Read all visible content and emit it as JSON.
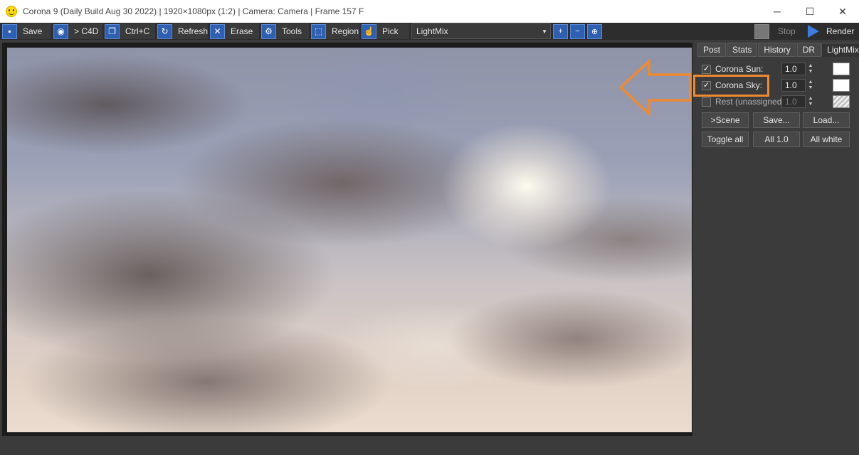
{
  "window": {
    "title": "Corona 9 (Daily Build Aug 30 2022) | 1920×1080px (1:2) | Camera: Camera | Frame 157 F",
    "minimize": "─",
    "maximize": "☐",
    "close": "✕"
  },
  "toolbar": {
    "save": "Save",
    "to_c4d": "> C4D",
    "copy": "Ctrl+C",
    "refresh": "Refresh",
    "erase": "Erase",
    "tools": "Tools",
    "region": "Region",
    "pick": "Pick",
    "lightmix_select": "LightMix",
    "stop": "Stop",
    "render": "Render"
  },
  "panel": {
    "tabs": [
      "Post",
      "Stats",
      "History",
      "DR",
      "LightMix"
    ],
    "active_tab": "LightMix",
    "lights": [
      {
        "label": "Corona Sun:",
        "checked": true,
        "value": "1.0",
        "color": "#ffffff"
      },
      {
        "label": "Corona Sky:",
        "checked": true,
        "value": "1.0",
        "color": "#ffffff",
        "highlighted": true
      },
      {
        "label": "Rest (unassigned):",
        "checked": false,
        "value": "1.0",
        "color": "hatched"
      }
    ],
    "buttons_row1": [
      ">Scene",
      "Save...",
      "Load..."
    ],
    "buttons_row2": [
      "Toggle all",
      "All 1.0",
      "All white"
    ]
  },
  "annotation": {
    "arrow_color": "#f08a30",
    "highlight_color": "#f08a30"
  }
}
